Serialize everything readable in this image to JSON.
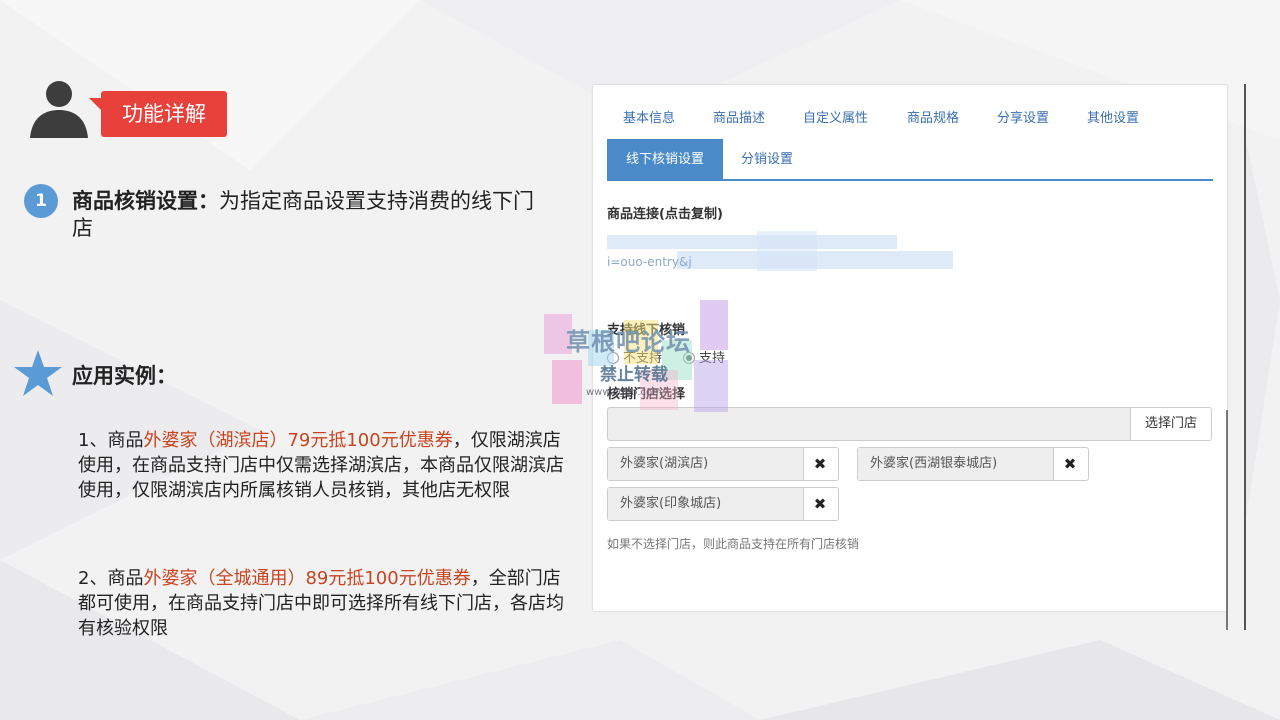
{
  "slide": {
    "section_tag": "功能详解",
    "badge_number": "1",
    "feature_title": "商品核销设置：",
    "feature_desc": "为指定商品设置支持消费的线下门店",
    "example_title": "应用实例：",
    "example1": {
      "prefix": "1、商品",
      "highlight": "外婆家（湖滨店）79元抵100元优惠券",
      "suffix": "，仅限湖滨店使用，在商品支持门店中仅需选择湖滨店，本商品仅限湖滨店使用，仅限湖滨店内所属核销人员核销，其他店无权限"
    },
    "example2": {
      "prefix": "2、商品",
      "highlight": "外婆家（全城通用）89元抵100元优惠券",
      "suffix": "，全部门店都可使用，在商品支持门店中即可选择所有线下门店，各店均有核验权限"
    },
    "highlight_color": "#c8441f",
    "accent_color": "#e8403b"
  },
  "panel": {
    "tabs_row1": [
      "基本信息",
      "商品描述",
      "自定义属性",
      "商品规格",
      "分享设置",
      "其他设置"
    ],
    "tab_active": "线下核销设置",
    "tab_second": "分销设置",
    "link_label": "商品连接(点击复制)",
    "link_text": "i=ouo-entry&j",
    "support_label": "支持线下核销",
    "radio_no": "不支持",
    "radio_yes": "支持",
    "store_label": "核销门店选择",
    "store_button": "选择门店",
    "stores": [
      "外婆家(湖滨店)",
      "外婆家(西湖银泰城店)",
      "外婆家(印象城店)"
    ],
    "remove_glyph": "✖",
    "hint": "如果不选择门店，则此商品支持在所有门店核销",
    "tab_color": "#4a8ac8"
  },
  "watermark": {
    "title": "草根吧论坛",
    "subtitle": "禁止转载",
    "url": "www.cgbb.com"
  }
}
